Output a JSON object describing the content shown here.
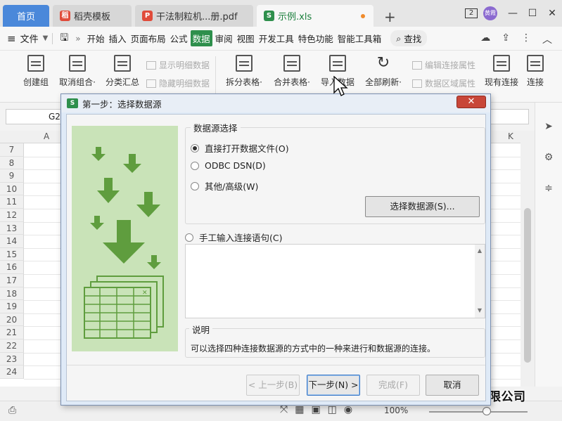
{
  "tabs": {
    "home": "首页",
    "template": "稻壳模板",
    "pdf": "干法制粒机...册.pdf",
    "xls": "示例.xls"
  },
  "window": {
    "badge": "2",
    "avatar": "黄霞"
  },
  "menu": {
    "file": "文件",
    "items": [
      "开始",
      "插入",
      "页面布局",
      "公式",
      "数据",
      "审阅",
      "视图",
      "开发工具",
      "特色功能",
      "智能工具箱"
    ],
    "active_index": 4,
    "search": "查找"
  },
  "ribbon": {
    "create_group": "创建组",
    "ungroup": "取消组合·",
    "subtotal": "分类汇总",
    "show_detail": "显示明细数据",
    "hide_detail": "隐藏明细数据",
    "split_table": "拆分表格·",
    "merge_table": "合并表格·",
    "import_data": "导入数据",
    "refresh_all": "全部刷新·",
    "edit_conn": "编辑连接属性",
    "data_range": "数据区域属性",
    "existing_conn": "现有连接",
    "connect": "连接"
  },
  "formula": {
    "cell_ref": "G2"
  },
  "grid": {
    "columns": [
      "A",
      "K"
    ],
    "rows": [
      "7",
      "8",
      "9",
      "10",
      "11",
      "12",
      "13",
      "14",
      "15",
      "16",
      "17",
      "18",
      "19",
      "20",
      "21",
      "22",
      "23",
      "24"
    ]
  },
  "status": {
    "zoom": "100%"
  },
  "watermark": "宁波市华拳机械科技有限公司",
  "dialog": {
    "title": "第一步：选择数据源",
    "close": "✕",
    "group_label": "数据源选择",
    "opt_direct": "直接打开数据文件(O)",
    "opt_odbc": "ODBC DSN(D)",
    "opt_other": "其他/高级(W)",
    "choose_btn": "选择数据源(S)...",
    "opt_manual": "手工输入连接语句(C)",
    "desc_label": "说明",
    "desc_text": "可以选择四种连接数据源的方式中的一种来进行和数据源的连接。",
    "btn_prev": "< 上一步(B)",
    "btn_next": "下一步(N) >",
    "btn_finish": "完成(F)",
    "btn_cancel": "取消"
  }
}
